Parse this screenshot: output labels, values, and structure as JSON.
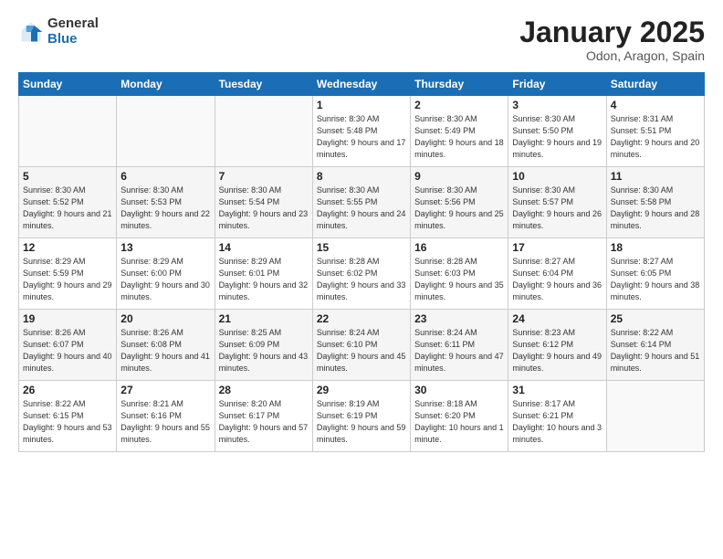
{
  "logo": {
    "general": "General",
    "blue": "Blue"
  },
  "title": "January 2025",
  "subtitle": "Odon, Aragon, Spain",
  "days_of_week": [
    "Sunday",
    "Monday",
    "Tuesday",
    "Wednesday",
    "Thursday",
    "Friday",
    "Saturday"
  ],
  "weeks": [
    [
      {
        "day": "",
        "info": ""
      },
      {
        "day": "",
        "info": ""
      },
      {
        "day": "",
        "info": ""
      },
      {
        "day": "1",
        "info": "Sunrise: 8:30 AM\nSunset: 5:48 PM\nDaylight: 9 hours\nand 17 minutes."
      },
      {
        "day": "2",
        "info": "Sunrise: 8:30 AM\nSunset: 5:49 PM\nDaylight: 9 hours\nand 18 minutes."
      },
      {
        "day": "3",
        "info": "Sunrise: 8:30 AM\nSunset: 5:50 PM\nDaylight: 9 hours\nand 19 minutes."
      },
      {
        "day": "4",
        "info": "Sunrise: 8:31 AM\nSunset: 5:51 PM\nDaylight: 9 hours\nand 20 minutes."
      }
    ],
    [
      {
        "day": "5",
        "info": "Sunrise: 8:30 AM\nSunset: 5:52 PM\nDaylight: 9 hours\nand 21 minutes."
      },
      {
        "day": "6",
        "info": "Sunrise: 8:30 AM\nSunset: 5:53 PM\nDaylight: 9 hours\nand 22 minutes."
      },
      {
        "day": "7",
        "info": "Sunrise: 8:30 AM\nSunset: 5:54 PM\nDaylight: 9 hours\nand 23 minutes."
      },
      {
        "day": "8",
        "info": "Sunrise: 8:30 AM\nSunset: 5:55 PM\nDaylight: 9 hours\nand 24 minutes."
      },
      {
        "day": "9",
        "info": "Sunrise: 8:30 AM\nSunset: 5:56 PM\nDaylight: 9 hours\nand 25 minutes."
      },
      {
        "day": "10",
        "info": "Sunrise: 8:30 AM\nSunset: 5:57 PM\nDaylight: 9 hours\nand 26 minutes."
      },
      {
        "day": "11",
        "info": "Sunrise: 8:30 AM\nSunset: 5:58 PM\nDaylight: 9 hours\nand 28 minutes."
      }
    ],
    [
      {
        "day": "12",
        "info": "Sunrise: 8:29 AM\nSunset: 5:59 PM\nDaylight: 9 hours\nand 29 minutes."
      },
      {
        "day": "13",
        "info": "Sunrise: 8:29 AM\nSunset: 6:00 PM\nDaylight: 9 hours\nand 30 minutes."
      },
      {
        "day": "14",
        "info": "Sunrise: 8:29 AM\nSunset: 6:01 PM\nDaylight: 9 hours\nand 32 minutes."
      },
      {
        "day": "15",
        "info": "Sunrise: 8:28 AM\nSunset: 6:02 PM\nDaylight: 9 hours\nand 33 minutes."
      },
      {
        "day": "16",
        "info": "Sunrise: 8:28 AM\nSunset: 6:03 PM\nDaylight: 9 hours\nand 35 minutes."
      },
      {
        "day": "17",
        "info": "Sunrise: 8:27 AM\nSunset: 6:04 PM\nDaylight: 9 hours\nand 36 minutes."
      },
      {
        "day": "18",
        "info": "Sunrise: 8:27 AM\nSunset: 6:05 PM\nDaylight: 9 hours\nand 38 minutes."
      }
    ],
    [
      {
        "day": "19",
        "info": "Sunrise: 8:26 AM\nSunset: 6:07 PM\nDaylight: 9 hours\nand 40 minutes."
      },
      {
        "day": "20",
        "info": "Sunrise: 8:26 AM\nSunset: 6:08 PM\nDaylight: 9 hours\nand 41 minutes."
      },
      {
        "day": "21",
        "info": "Sunrise: 8:25 AM\nSunset: 6:09 PM\nDaylight: 9 hours\nand 43 minutes."
      },
      {
        "day": "22",
        "info": "Sunrise: 8:24 AM\nSunset: 6:10 PM\nDaylight: 9 hours\nand 45 minutes."
      },
      {
        "day": "23",
        "info": "Sunrise: 8:24 AM\nSunset: 6:11 PM\nDaylight: 9 hours\nand 47 minutes."
      },
      {
        "day": "24",
        "info": "Sunrise: 8:23 AM\nSunset: 6:12 PM\nDaylight: 9 hours\nand 49 minutes."
      },
      {
        "day": "25",
        "info": "Sunrise: 8:22 AM\nSunset: 6:14 PM\nDaylight: 9 hours\nand 51 minutes."
      }
    ],
    [
      {
        "day": "26",
        "info": "Sunrise: 8:22 AM\nSunset: 6:15 PM\nDaylight: 9 hours\nand 53 minutes."
      },
      {
        "day": "27",
        "info": "Sunrise: 8:21 AM\nSunset: 6:16 PM\nDaylight: 9 hours\nand 55 minutes."
      },
      {
        "day": "28",
        "info": "Sunrise: 8:20 AM\nSunset: 6:17 PM\nDaylight: 9 hours\nand 57 minutes."
      },
      {
        "day": "29",
        "info": "Sunrise: 8:19 AM\nSunset: 6:19 PM\nDaylight: 9 hours\nand 59 minutes."
      },
      {
        "day": "30",
        "info": "Sunrise: 8:18 AM\nSunset: 6:20 PM\nDaylight: 10 hours\nand 1 minute."
      },
      {
        "day": "31",
        "info": "Sunrise: 8:17 AM\nSunset: 6:21 PM\nDaylight: 10 hours\nand 3 minutes."
      },
      {
        "day": "",
        "info": ""
      }
    ]
  ]
}
